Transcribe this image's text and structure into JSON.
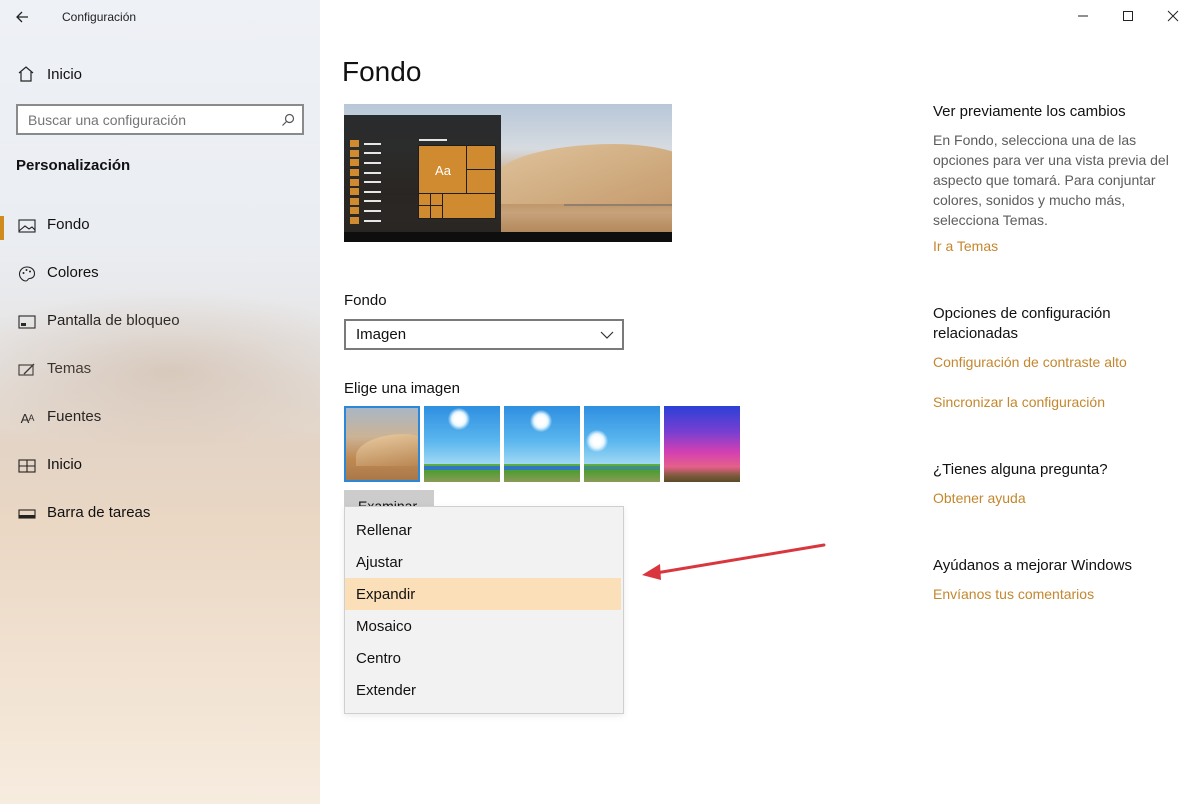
{
  "window": {
    "title": "Configuración"
  },
  "sidebar": {
    "home_label": "Inicio",
    "search_placeholder": "Buscar una configuración",
    "section_title": "Personalización",
    "items": [
      {
        "label": "Fondo",
        "icon": "picture-icon",
        "active": true
      },
      {
        "label": "Colores",
        "icon": "palette-icon",
        "active": false
      },
      {
        "label": "Pantalla de bloqueo",
        "icon": "lock-screen-icon",
        "active": false
      },
      {
        "label": "Temas",
        "icon": "themes-icon",
        "active": false
      },
      {
        "label": "Fuentes",
        "icon": "fonts-icon",
        "active": false
      },
      {
        "label": "Inicio",
        "icon": "start-icon",
        "active": false
      },
      {
        "label": "Barra de tareas",
        "icon": "taskbar-icon",
        "active": false
      }
    ]
  },
  "main": {
    "title": "Fondo",
    "preview_tile_text": "Aa",
    "background_label": "Fondo",
    "background_value": "Imagen",
    "choose_image_label": "Elige una imagen",
    "browse_label": "Examinar",
    "fit_options": [
      "Rellenar",
      "Ajustar",
      "Expandir",
      "Mosaico",
      "Centro",
      "Extender"
    ],
    "selected_fit": "Expandir"
  },
  "right": {
    "preview_heading": "Ver previamente los cambios",
    "preview_text": "En Fondo, selecciona una de las opciones para ver una vista previa del aspecto que tomará. Para conjuntar colores, sonidos y mucho más, selecciona Temas.",
    "themes_link": "Ir a Temas",
    "related_heading": "Opciones de configuración relacionadas",
    "contrast_link": "Configuración de contraste alto",
    "sync_link": "Sincronizar la configuración",
    "question_heading": "¿Tienes alguna pregunta?",
    "help_link": "Obtener ayuda",
    "improve_heading": "Ayúdanos a mejorar Windows",
    "feedback_link": "Envíanos tus comentarios"
  },
  "colors": {
    "accent": "#d08b1e",
    "link": "#c4872e",
    "selected_row": "#fbdfb8",
    "annotation_arrow": "#d9363e"
  }
}
